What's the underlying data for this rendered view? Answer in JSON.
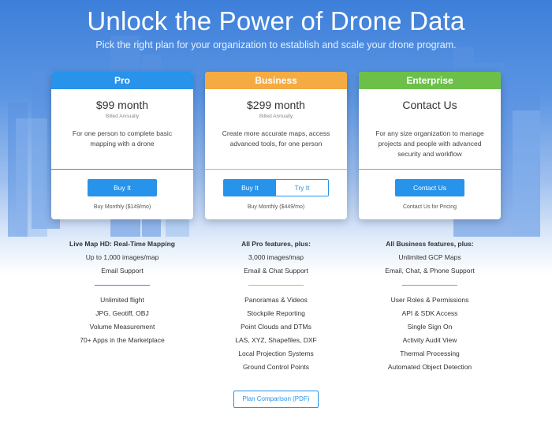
{
  "hero": {
    "title": "Unlock the Power of Drone Data",
    "subtitle": "Pick the right plan for your organization to establish and scale your drone program."
  },
  "colors": {
    "pro": "#2793ea",
    "business": "#f4ab42",
    "enterprise": "#6cc04a",
    "button": "#2793ea"
  },
  "plans": [
    {
      "name": "Pro",
      "price": "$99 month",
      "billed": "Billed Annually",
      "description": "For one person to complete basic mapping with a drone",
      "primary_button": "Buy It",
      "footnote": "Buy Monthly ($149/mo)"
    },
    {
      "name": "Business",
      "price": "$299 month",
      "billed": "Billed Annually",
      "description": "Create more accurate maps, access advanced tools, for one person",
      "primary_button": "Buy It",
      "secondary_button": "Try It",
      "footnote": "Buy Monthly ($449/mo)"
    },
    {
      "name": "Enterprise",
      "price": "Contact Us",
      "description": "For any size organization to manage projects and people with advanced security and workflow",
      "primary_button": "Contact Us",
      "footnote": "Contact Us for Pricing"
    }
  ],
  "features": [
    {
      "top": [
        "Live Map HD: Real-Time Mapping",
        "Up to 1,000 images/map",
        "Email Support"
      ],
      "bottom": [
        "Unlimited flight",
        "JPG, Geotiff, OBJ",
        "Volume Measurement",
        "70+ Apps in the Marketplace"
      ]
    },
    {
      "top": [
        "All Pro features, plus:",
        "3,000 images/map",
        "Email & Chat Support"
      ],
      "bottom": [
        "Panoramas & Videos",
        "Stockpile Reporting",
        "Point Clouds and DTMs",
        "LAS, XYZ, Shapefiles, DXF",
        "Local Projection Systems",
        "Ground Control Points"
      ]
    },
    {
      "top": [
        "All Business features, plus:",
        "Unlimited GCP Maps",
        "Email, Chat, & Phone Support"
      ],
      "bottom": [
        "User Roles & Permissions",
        "API & SDK Access",
        "Single Sign On",
        "Activity Audit View",
        "Thermal Processing",
        "Automated Object Detection"
      ]
    }
  ],
  "pdf_button": "Plan Comparison (PDF)"
}
